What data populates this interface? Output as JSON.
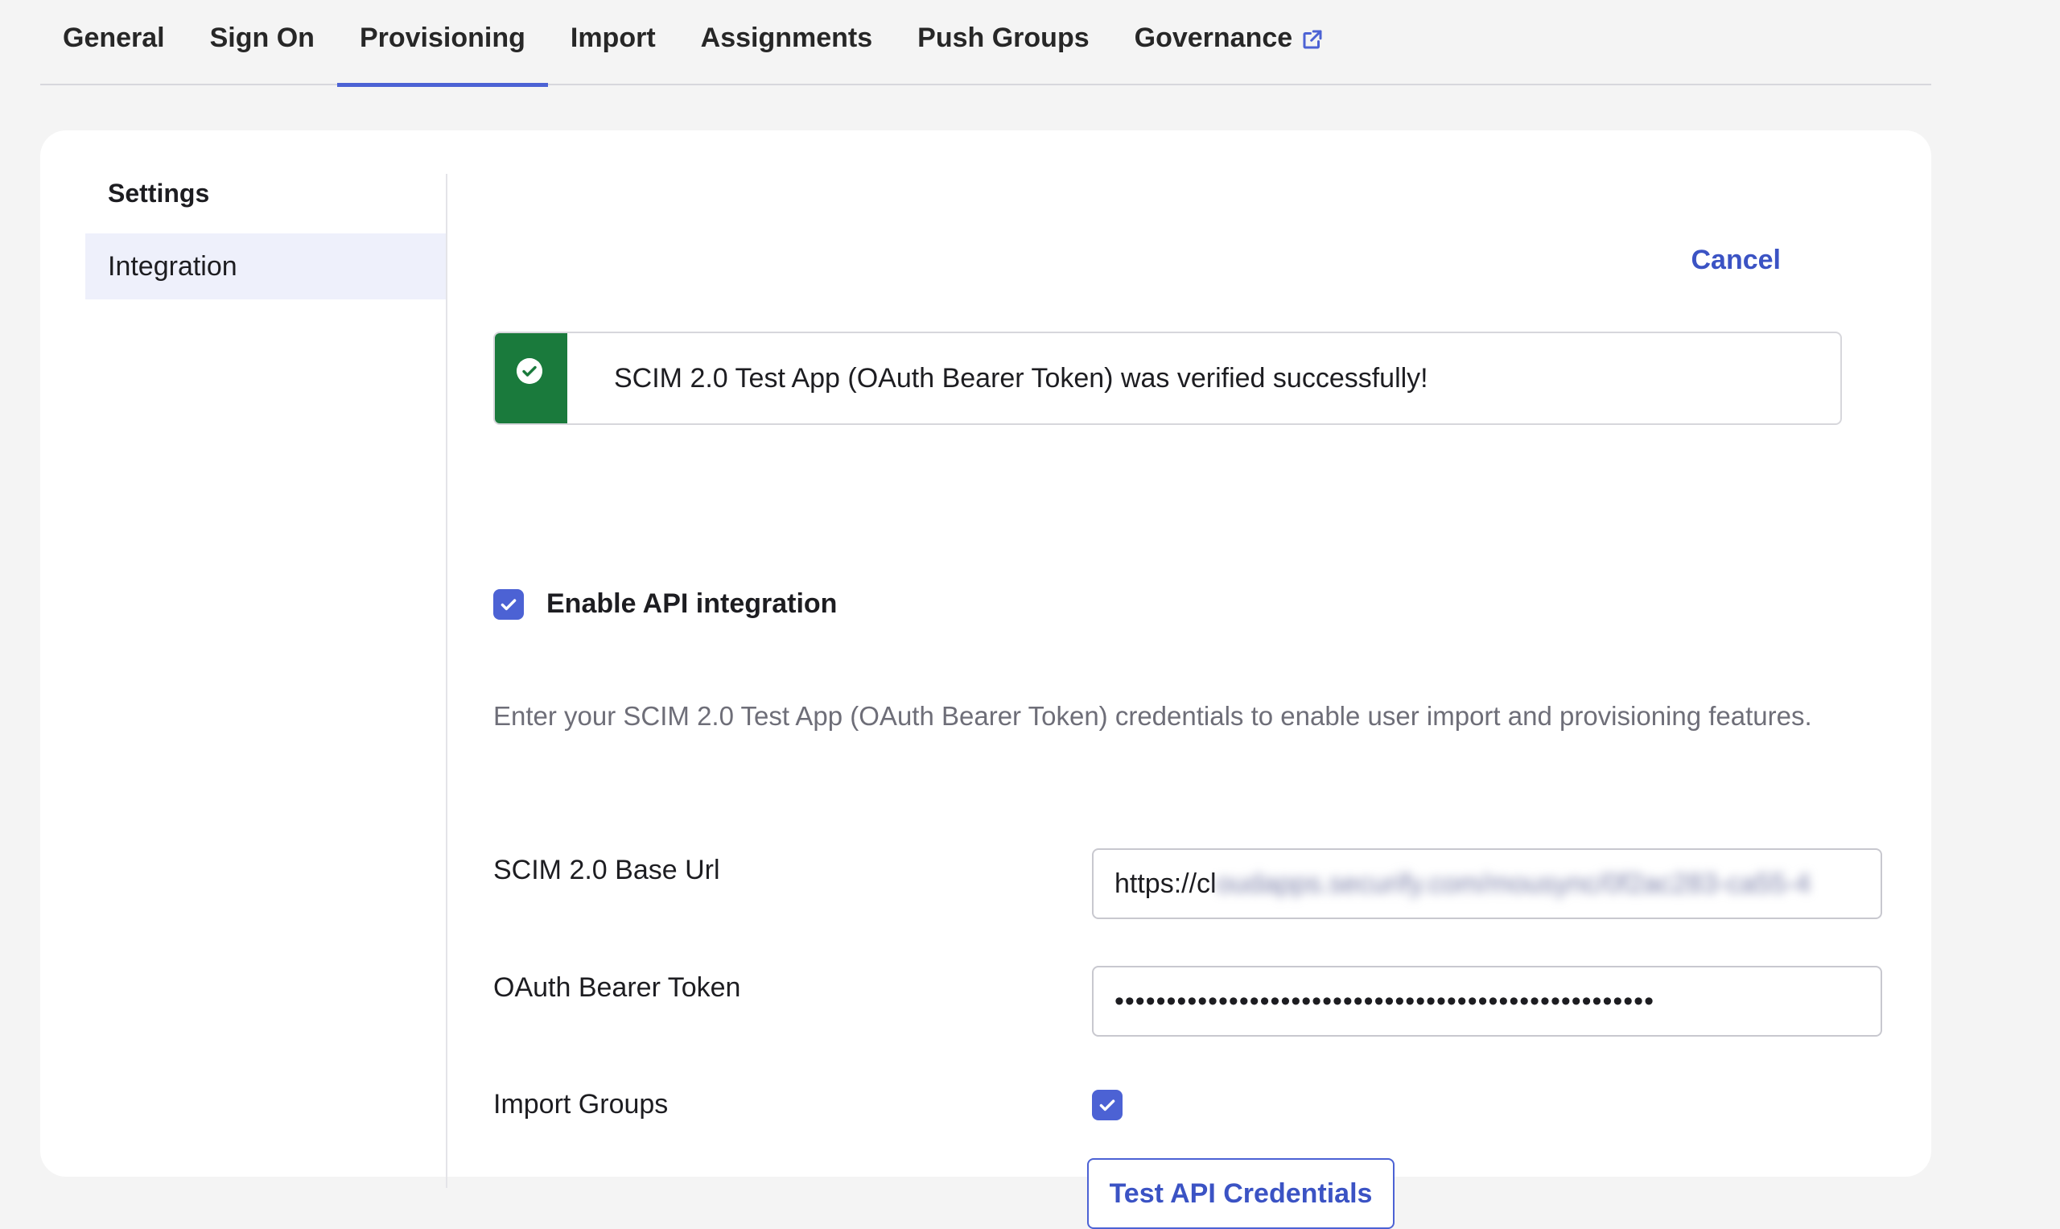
{
  "tabs": [
    {
      "label": "General"
    },
    {
      "label": "Sign On"
    },
    {
      "label": "Provisioning",
      "active": true
    },
    {
      "label": "Import"
    },
    {
      "label": "Assignments"
    },
    {
      "label": "Push Groups"
    },
    {
      "label": "Governance",
      "external": true
    }
  ],
  "sidebar": {
    "heading": "Settings",
    "items": [
      {
        "label": "Integration",
        "selected": true
      }
    ]
  },
  "actions": {
    "cancel": "Cancel"
  },
  "alert": {
    "message": "SCIM 2.0 Test App (OAuth Bearer Token) was verified successfully!",
    "status_color": "#1a7a3c"
  },
  "enable_api": {
    "label": "Enable API integration",
    "checked": true
  },
  "description": "Enter your SCIM 2.0 Test App (OAuth Bearer Token) credentials to enable user import and provisioning features.",
  "fields": {
    "base_url": {
      "label": "SCIM 2.0 Base Url",
      "value_visible": "https://cl",
      "value_obscured": "oudapps.securify.com/mousync/0f2ac283-ca55-4"
    },
    "token": {
      "label": "OAuth Bearer Token",
      "value_masked": "••••••••••••••••••••••••••••••••••••••••••••••••••••"
    },
    "import_groups": {
      "label": "Import Groups",
      "checked": true
    }
  },
  "buttons": {
    "test_api": "Test API Credentials"
  },
  "colors": {
    "accent": "#4c62d4",
    "link": "#3b53c4",
    "success": "#1a7a3c"
  },
  "icons": {
    "external_link": "external-link-icon",
    "check": "check-icon",
    "success": "check-circle-icon"
  }
}
